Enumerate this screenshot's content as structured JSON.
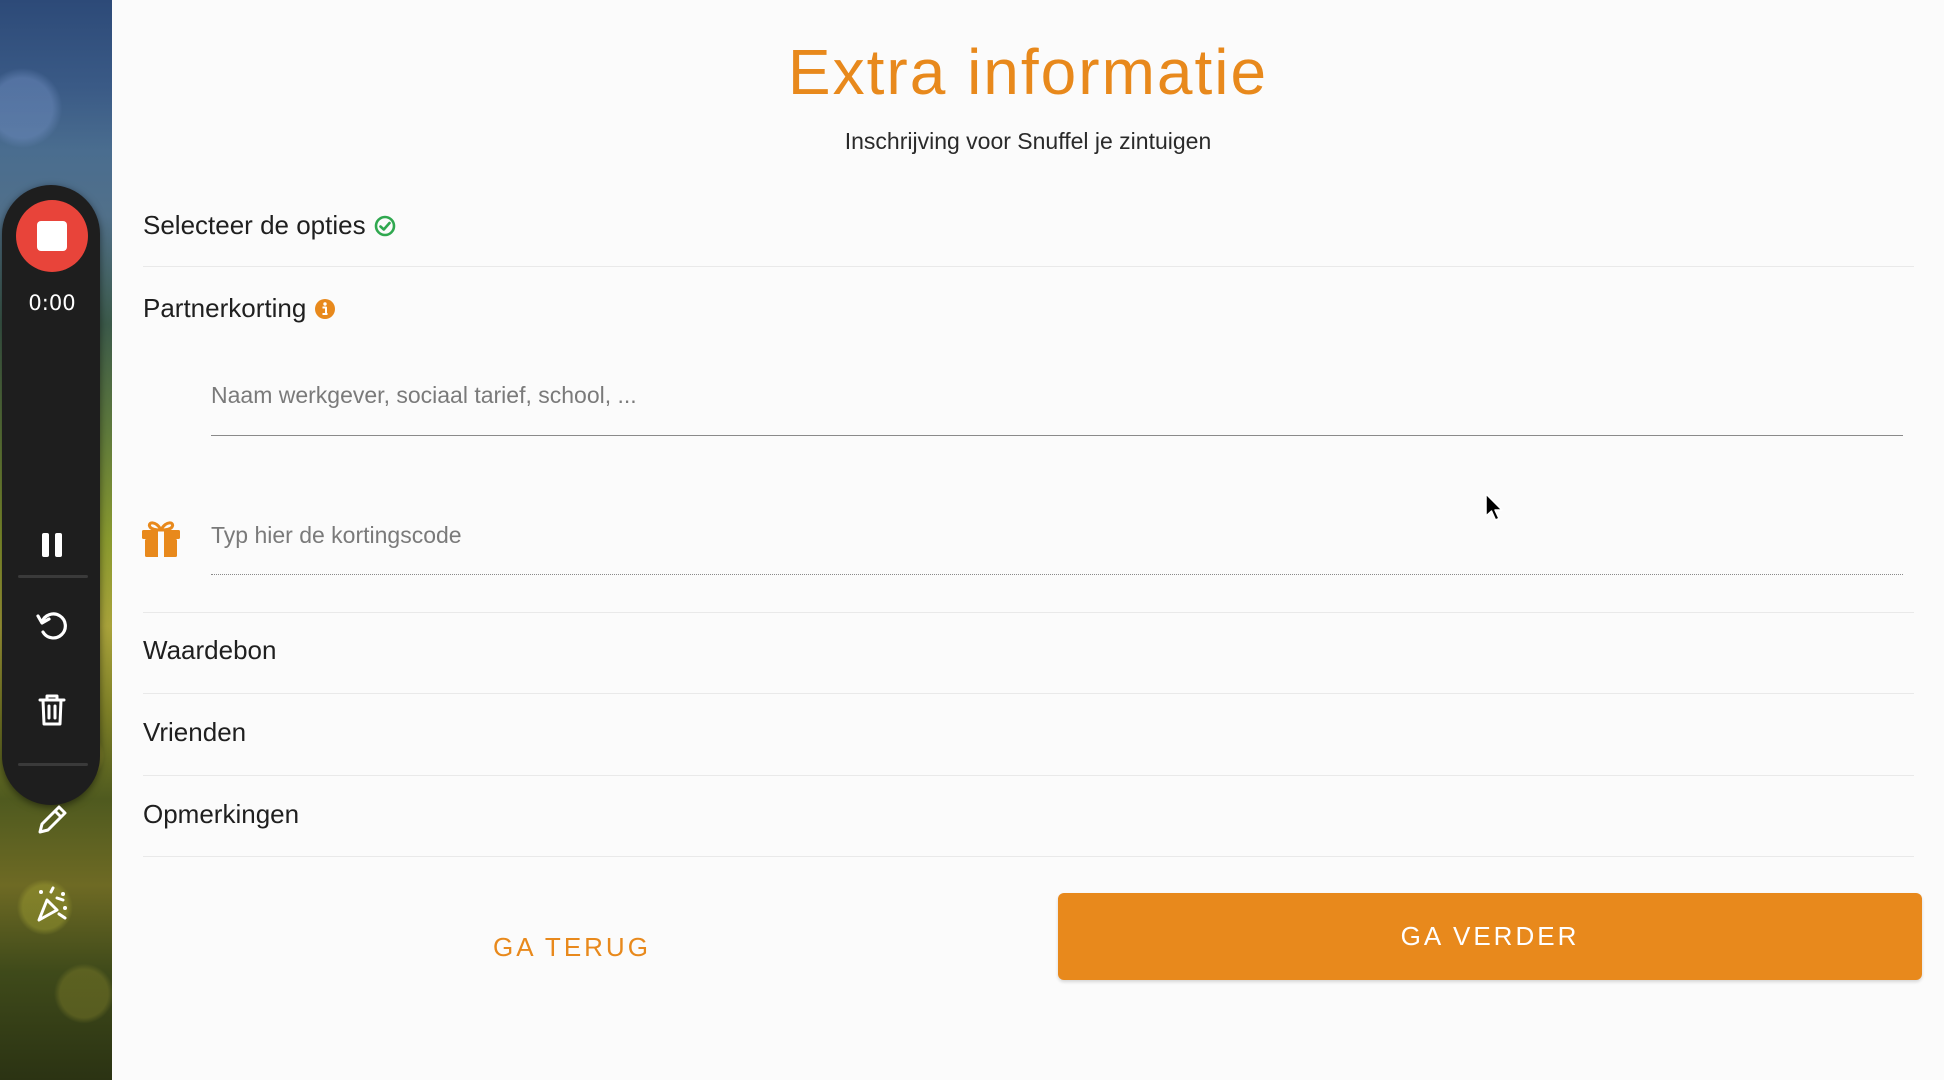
{
  "recorder": {
    "timer": "0:00",
    "icons": [
      "stop-icon",
      "pause-icon",
      "restart-icon",
      "trash-icon",
      "pencil-icon",
      "effects-icon"
    ],
    "stop_color": "#e8443a"
  },
  "form": {
    "title": "Extra informatie",
    "subtitle": "Inschrijving voor Snuffel je zintuigen",
    "accent_color": "#e8891c",
    "sections": {
      "options": "Selecteer de opties",
      "partner_discount": "Partnerkorting",
      "voucher": "Waardebon",
      "friends": "Vrienden",
      "remarks": "Opmerkingen"
    },
    "partner_input": {
      "placeholder": "Naam werkgever, sociaal tarief, school, ...",
      "value": ""
    },
    "discount_code_input": {
      "placeholder": "Typ hier de kortingscode",
      "value": ""
    },
    "buttons": {
      "back": "GA TERUG",
      "next": "GA VERDER"
    }
  }
}
